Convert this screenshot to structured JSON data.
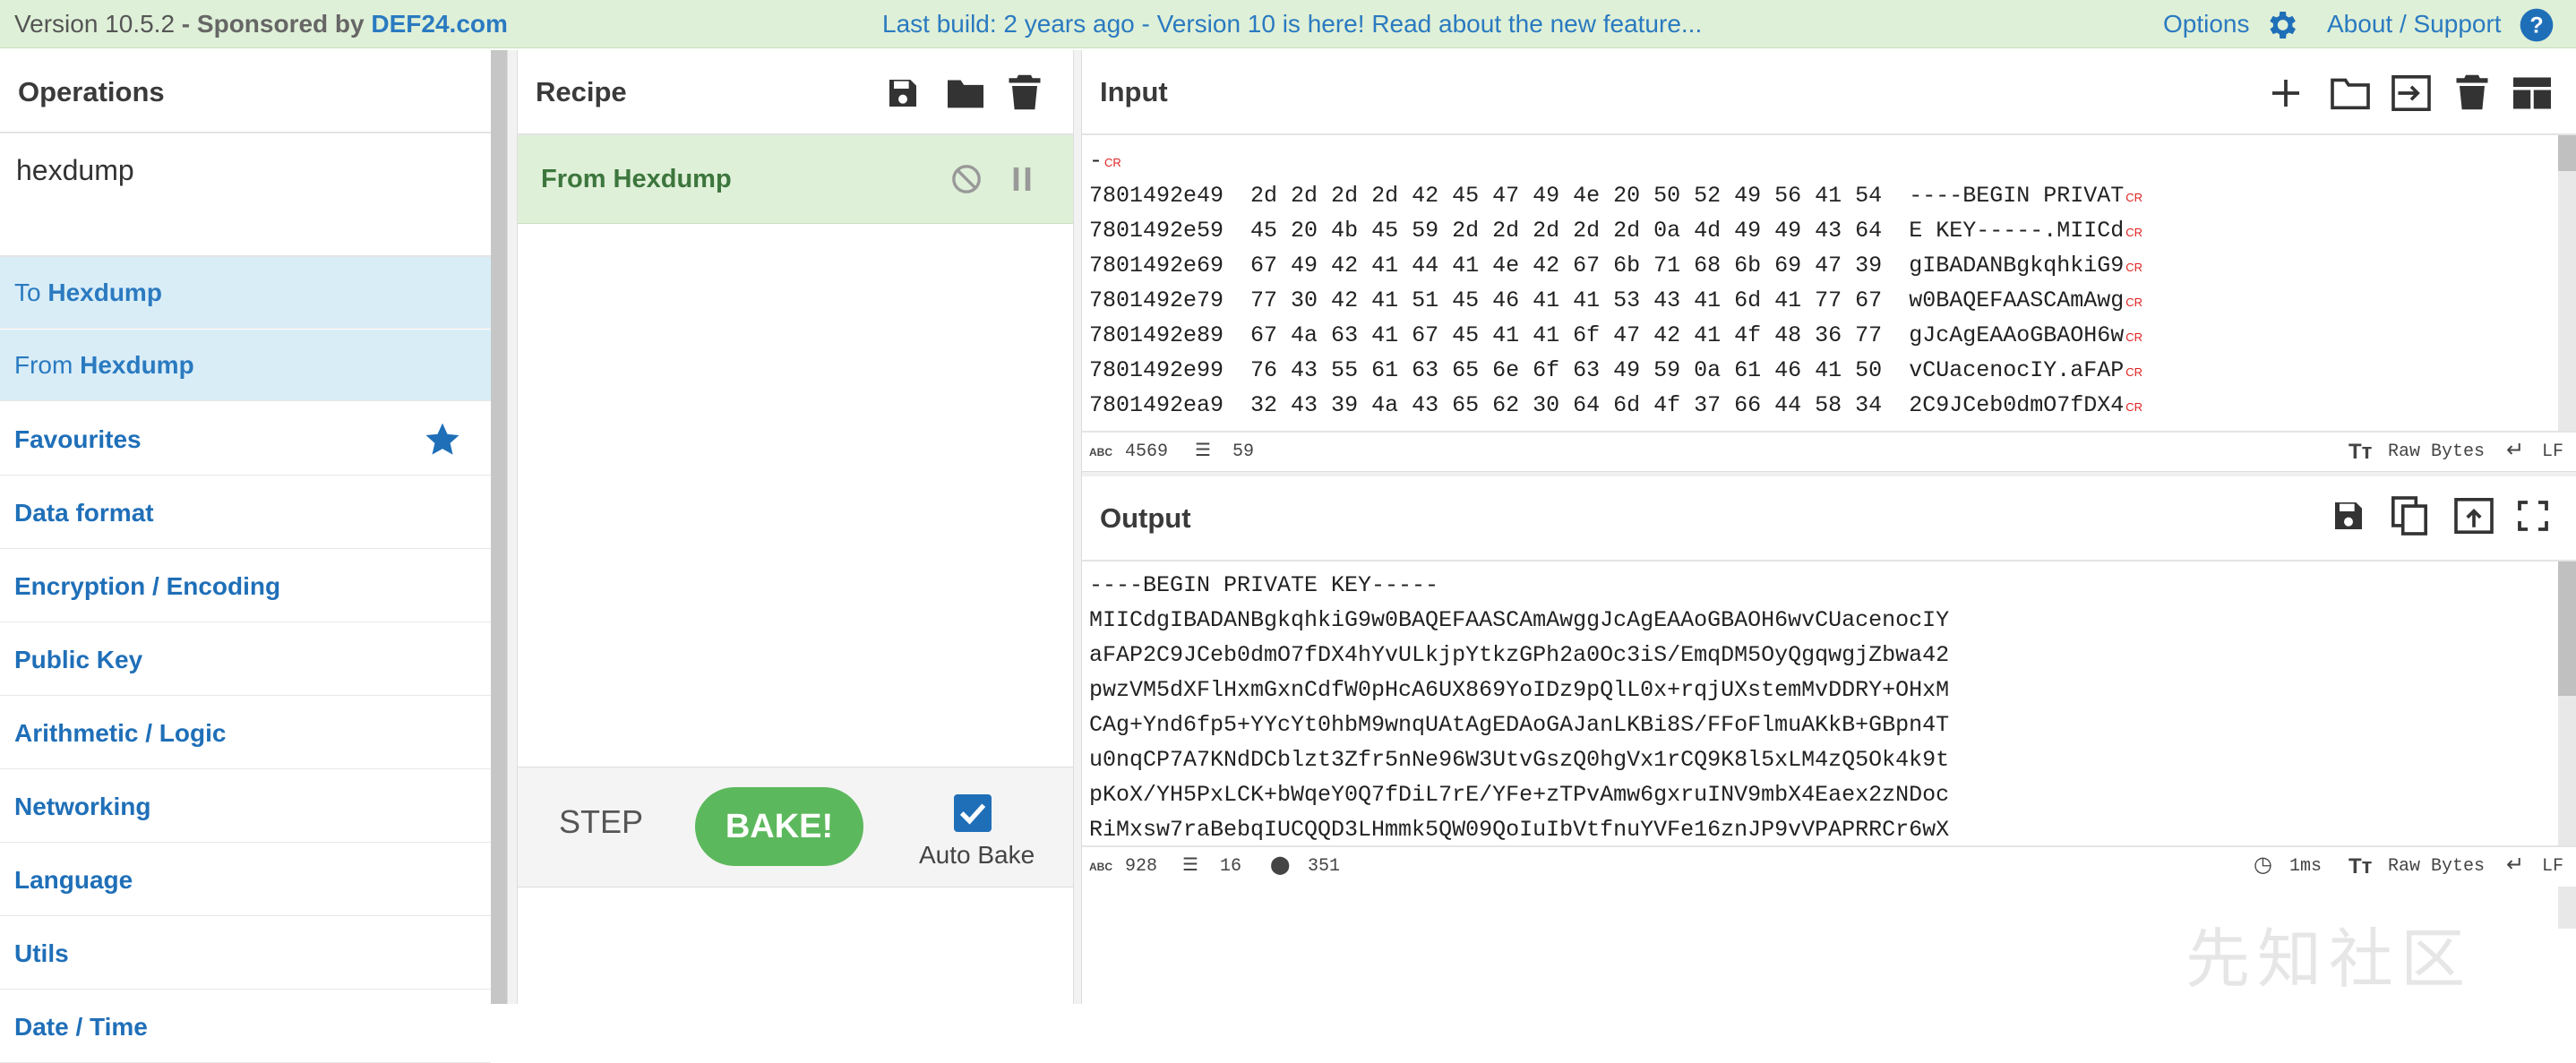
{
  "banner": {
    "version": "Version 10.5.2",
    "sponsored_prefix": " - Sponsored by ",
    "sponsor": "DEF24.com",
    "build_message": "Last build: 2 years ago - Version 10 is here! Read about the new feature...",
    "options_label": "Options",
    "about_label": "About / Support"
  },
  "operations": {
    "title": "Operations",
    "search_value": "hexdump",
    "results": [
      {
        "prefix": "To ",
        "match": "Hexdump"
      },
      {
        "prefix": "From ",
        "match": "Hexdump"
      }
    ],
    "categories": [
      "Favourites",
      "Data format",
      "Encryption / Encoding",
      "Public Key",
      "Arithmetic / Logic",
      "Networking",
      "Language",
      "Utils",
      "Date / Time"
    ]
  },
  "recipe": {
    "title": "Recipe",
    "items": [
      "From Hexdump"
    ],
    "step_label": "STEP",
    "bake_label": "BAKE!",
    "autobake_label": "Auto Bake",
    "autobake_checked": true
  },
  "input": {
    "title": "Input",
    "first_line": "-",
    "lines": [
      {
        "offset": "7801492e49",
        "hex": "2d 2d 2d 2d 42 45 47 49 4e 20 50 52 49 56 41 54",
        "ascii": "----BEGIN PRIVAT"
      },
      {
        "offset": "7801492e59",
        "hex": "45 20 4b 45 59 2d 2d 2d 2d 2d 0a 4d 49 49 43 64",
        "ascii": "E KEY-----.MIICd"
      },
      {
        "offset": "7801492e69",
        "hex": "67 49 42 41 44 41 4e 42 67 6b 71 68 6b 69 47 39",
        "ascii": "gIBADANBgkqhkiG9"
      },
      {
        "offset": "7801492e79",
        "hex": "77 30 42 41 51 45 46 41 41 53 43 41 6d 41 77 67",
        "ascii": "w0BAQEFAASCAmAwg"
      },
      {
        "offset": "7801492e89",
        "hex": "67 4a 63 41 67 45 41 41 6f 47 42 41 4f 48 36 77",
        "ascii": "gJcAgEAAoGBAOH6w"
      },
      {
        "offset": "7801492e99",
        "hex": "76 43 55 61 63 65 6e 6f 63 49 59 0a 61 46 41 50",
        "ascii": "vCUacenocIY.aFAP"
      },
      {
        "offset": "7801492ea9",
        "hex": "32 43 39 4a 43 65 62 30 64 6d 4f 37 66 44 58 34",
        "ascii": "2C9JCeb0dmO7fDX4"
      }
    ],
    "cr_marker": "CR",
    "stats": {
      "abc": "ABC",
      "length": "4569",
      "lines": "59"
    },
    "format": "Raw Bytes",
    "eol": "LF"
  },
  "output": {
    "title": "Output",
    "lines": [
      "----BEGIN PRIVATE KEY-----",
      "MIICdgIBADANBgkqhkiG9w0BAQEFAASCAmAwggJcAgEAAoGBAOH6wvCUacenocIY",
      "aFAP2C9JCeb0dmO7fDX4hYvULkjpYtkzGPh2a0Oc3iS/EmqDM5OyQgqwgjZbwa42",
      "pwzVM5dXFlHxmGxnCdfW0pHcA6UX869YoIDz9pQlL0x+rqjUXstemMvDDRY+OHxM",
      "CAg+Ynd6fp5+YYcYt0hbM9wnqUAtAgEDAoGAJanLKBi8S/FFoFlmuAKkB+GBpn4T",
      "u0nqCP7A7KNdDCblzt3Zfr5nNe96W3UtvGszQ0hgVx1rCQ9K8l5xLM4zQ5Ok4k9t",
      "pKoX/YH5PxLCK+bWqeY0Q7fDiL7rE/YFe+zTPvAmw6gxruINV9mbX4Eaex2zNDoc",
      "RiMxsw7raBebqIUCQQD3LHmmk5QW09QoIuIbVtfnuYVFe16znJP9vVPAPRRCr6wX"
    ],
    "stats": {
      "abc": "ABC",
      "length": "928",
      "lines": "16",
      "position": "351"
    },
    "time": "1ms",
    "format": "Raw Bytes",
    "eol": "LF"
  },
  "watermark": "先知社区",
  "colors": {
    "banner_bg": "#dff0d8",
    "link_blue": "#2a7ac0",
    "category_blue": "#1f6fb8",
    "search_result_bg": "#d9edf7",
    "recipe_item_bg": "#dff0d8",
    "recipe_item_text": "#3c763d",
    "bake_green": "#5cb85c",
    "cr_red": "#e02020"
  },
  "icons": {
    "banner": [
      "gear-icon",
      "help-icon"
    ],
    "recipe": [
      "save-icon",
      "folder-icon",
      "trash-icon",
      "disable-icon",
      "pause-icon"
    ],
    "input": [
      "plus-icon",
      "folder-icon",
      "swap-icon",
      "trash-icon",
      "layout-icon"
    ],
    "output": [
      "save-icon",
      "copy-icon",
      "replace-input-icon",
      "maximize-icon"
    ],
    "favourites": "star-icon"
  }
}
